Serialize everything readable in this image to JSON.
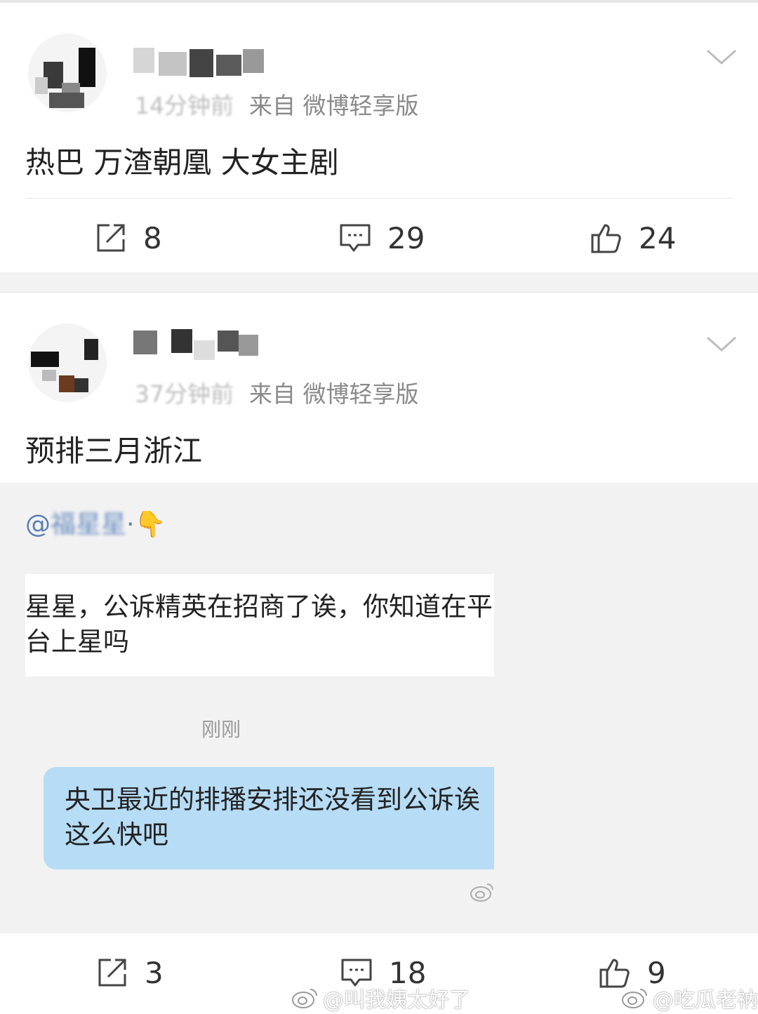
{
  "posts": [
    {
      "meta": {
        "time": "14分钟前",
        "source": "来自 微博轻享版"
      },
      "content": "热巴 万渣朝凰 大女主剧",
      "actions": {
        "repost": "8",
        "comment": "29",
        "like": "24"
      }
    },
    {
      "meta": {
        "time": "37分钟前",
        "source": "来自 微博轻享版"
      },
      "content": "预排三月浙江",
      "embed": {
        "mention_prefix": "@",
        "mention_blurred": "福星星",
        "mention_suffix": "·👇",
        "message_left": "星星，公诉精英在招商了诶，你知道在平台上星吗",
        "timestamp": "刚刚",
        "message_right": "央卫最近的排播安排还没看到公诉诶\n这么快吧"
      },
      "actions": {
        "repost": "3",
        "comment": "18",
        "like": "9"
      }
    }
  ],
  "watermarks": [
    "@叫我姨太好了",
    "@吃瓜老衲"
  ],
  "colors": {
    "background": "#f2f2f2",
    "bubble_blue": "#b7dcf5",
    "meta_gray": "#8a8a8a"
  }
}
